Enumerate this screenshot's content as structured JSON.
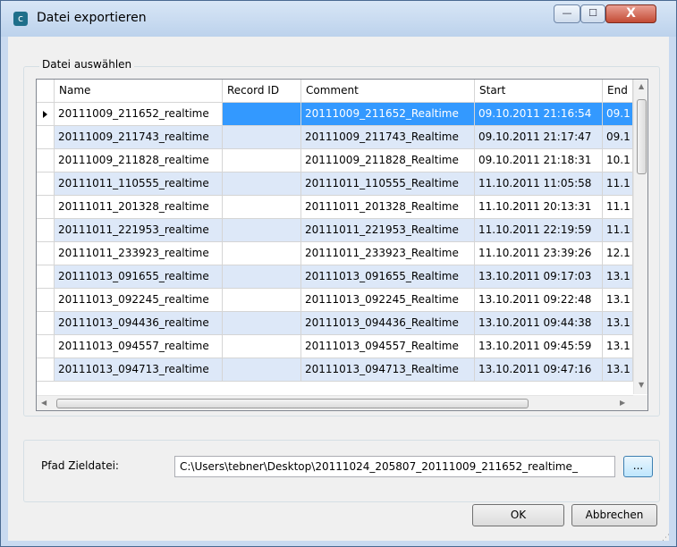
{
  "window": {
    "title": "Datei exportieren",
    "app_icon_glyph": "c",
    "minimize_glyph": "—",
    "maximize_glyph": "☐",
    "close_glyph": "X"
  },
  "group": {
    "label": "Datei auswählen"
  },
  "table": {
    "columns": [
      "Name",
      "Record ID",
      "Comment",
      "Start",
      "End"
    ],
    "selected_row": 0,
    "rows": [
      [
        "20111009_211652_realtime",
        "",
        "20111009_211652_Realtime",
        "09.10.2011 21:16:54",
        "09.1"
      ],
      [
        "20111009_211743_realtime",
        "",
        "20111009_211743_Realtime",
        "09.10.2011 21:17:47",
        "09.1"
      ],
      [
        "20111009_211828_realtime",
        "",
        "20111009_211828_Realtime",
        "09.10.2011 21:18:31",
        "10.1"
      ],
      [
        "20111011_110555_realtime",
        "",
        "20111011_110555_Realtime",
        "11.10.2011 11:05:58",
        "11.1"
      ],
      [
        "20111011_201328_realtime",
        "",
        "20111011_201328_Realtime",
        "11.10.2011 20:13:31",
        "11.1"
      ],
      [
        "20111011_221953_realtime",
        "",
        "20111011_221953_Realtime",
        "11.10.2011 22:19:59",
        "11.1"
      ],
      [
        "20111011_233923_realtime",
        "",
        "20111011_233923_Realtime",
        "11.10.2011 23:39:26",
        "12.1"
      ],
      [
        "20111013_091655_realtime",
        "",
        "20111013_091655_Realtime",
        "13.10.2011 09:17:03",
        "13.1"
      ],
      [
        "20111013_092245_realtime",
        "",
        "20111013_092245_Realtime",
        "13.10.2011 09:22:48",
        "13.1"
      ],
      [
        "20111013_094436_realtime",
        "",
        "20111013_094436_Realtime",
        "13.10.2011 09:44:38",
        "13.1"
      ],
      [
        "20111013_094557_realtime",
        "",
        "20111013_094557_Realtime",
        "13.10.2011 09:45:59",
        "13.1"
      ],
      [
        "20111013_094713_realtime",
        "",
        "20111013_094713_Realtime",
        "13.10.2011 09:47:16",
        "13.1"
      ]
    ]
  },
  "target": {
    "label": "Pfad Zieldatei:",
    "path_value": "C:\\Users\\tebner\\Desktop\\20111024_205807_20111009_211652_realtime_",
    "browse_label": "..."
  },
  "buttons": {
    "ok": "OK",
    "cancel": "Abbrechen"
  },
  "colors": {
    "selected_row": "#3399ff",
    "alternate_row": "#dde8f8",
    "window_frame": "#c9daf0",
    "close_button": "#c34b35"
  }
}
